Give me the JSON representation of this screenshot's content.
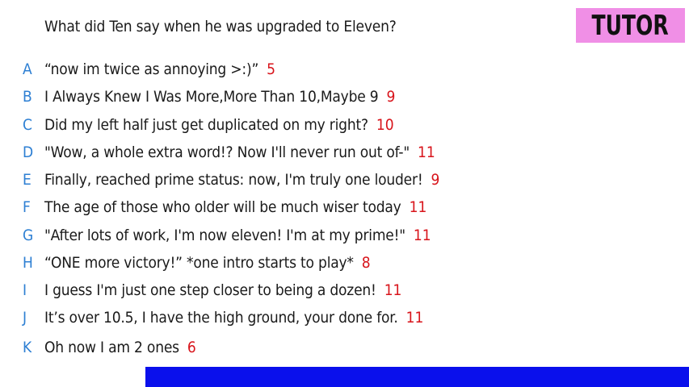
{
  "question": "What did Ten say when he was upgraded to Eleven?",
  "badge": "TUTOR",
  "answers": [
    {
      "letter": "A",
      "text": "“now im twice as annoying >:)”",
      "score": "5"
    },
    {
      "letter": "B",
      "text": "I Always Knew I Was More,More Than 10,Maybe 9",
      "score": "9"
    },
    {
      "letter": "C",
      "text": "Did my left half just get duplicated on my right?",
      "score": "10"
    },
    {
      "letter": "D",
      "text": "\"Wow, a whole extra word!? Now I'll never run out of-\"",
      "score": "11"
    },
    {
      "letter": "E",
      "text": "Finally, reached prime status: now, I'm truly one louder!",
      "score": "9"
    },
    {
      "letter": "F",
      "text": "The age of those who older will be much wiser today",
      "score": "11"
    },
    {
      "letter": "G",
      "text": "\"After lots of work, I'm now eleven! I'm at my prime!\"",
      "score": "11"
    },
    {
      "letter": "H",
      "text": "“ONE more victory!” *one intro starts to play*",
      "score": "8"
    },
    {
      "letter": "I",
      "text": "I guess I'm just one step closer to being a dozen!",
      "score": "11"
    },
    {
      "letter": "J",
      "text": "It’s over 10.5, I have the high ground, your done for.",
      "score": "11"
    },
    {
      "letter": "K",
      "text": "Oh now I am 2 ones",
      "score": "6"
    }
  ],
  "colors": {
    "letter": "#2d7fd3",
    "score": "#d8141b",
    "badge_bg": "#f08fe6",
    "bottom_bar": "#0a10ec"
  }
}
